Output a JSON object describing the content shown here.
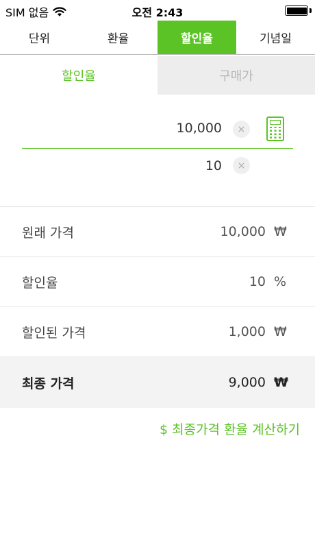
{
  "status_bar": {
    "carrier": "SIM 없음",
    "time": "오전 2:43"
  },
  "top_tabs": [
    {
      "label": "단위",
      "active": false
    },
    {
      "label": "환율",
      "active": false
    },
    {
      "label": "할인율",
      "active": true
    },
    {
      "label": "기념일",
      "active": false
    }
  ],
  "sub_tabs": [
    {
      "label": "할인율",
      "active": true
    },
    {
      "label": "구매가",
      "active": false
    }
  ],
  "inputs": {
    "price": {
      "value": "10,000",
      "clear": "×"
    },
    "rate": {
      "value": "10",
      "clear": "×"
    }
  },
  "results": [
    {
      "label": "원래 가격",
      "value": "10,000",
      "unit": "₩"
    },
    {
      "label": "할인율",
      "value": "10",
      "unit": "%"
    },
    {
      "label": "할인된 가격",
      "value": "1,000",
      "unit": "₩"
    },
    {
      "label": "최종 가격",
      "value": "9,000",
      "unit": "₩"
    }
  ],
  "exchange_link": "$ 최종가격 환율 계산하기",
  "colors": {
    "accent": "#5cc326",
    "inactive_tab_bg": "#ededed",
    "final_row_bg": "#f3f3f3"
  }
}
